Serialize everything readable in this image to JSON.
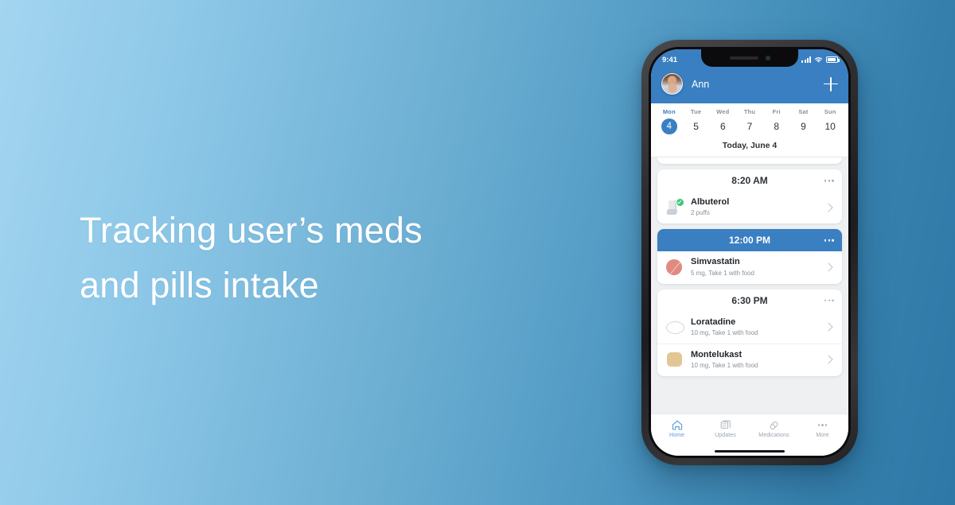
{
  "colors": {
    "brand_blue": "#3a7fc1",
    "bg_light": "#a3d5f0",
    "bg_dark": "#2d78a6",
    "accent_green": "#3fc47a",
    "muted": "#8a9097"
  },
  "promo": {
    "headline_line1": "Tracking user’s meds",
    "headline_line2": "and pills intake"
  },
  "phone": {
    "status_bar": {
      "time": "9:41",
      "signal_icon": "cellular-bars-icon",
      "wifi_icon": "wifi-icon",
      "battery_icon": "battery-icon"
    },
    "app_header": {
      "avatar_icon": "avatar",
      "user_name": "Ann",
      "add_icon": "plus-icon"
    },
    "date_strip": {
      "days": [
        {
          "name": "Mon",
          "num": "4",
          "selected": true
        },
        {
          "name": "Tue",
          "num": "5",
          "selected": false
        },
        {
          "name": "Wed",
          "num": "6",
          "selected": false
        },
        {
          "name": "Thu",
          "num": "7",
          "selected": false
        },
        {
          "name": "Fri",
          "num": "8",
          "selected": false
        },
        {
          "name": "Sat",
          "num": "9",
          "selected": false
        },
        {
          "name": "Sun",
          "num": "10",
          "selected": false
        }
      ],
      "today_label": "Today, June 4"
    },
    "schedule": [
      {
        "time": "8:20 AM",
        "highlight": false,
        "menu_icon": "more-dots-icon",
        "meds": [
          {
            "name": "Albuterol",
            "dose": "2 puffs",
            "icon": "inhaler-icon",
            "taken": true,
            "chevron_icon": "chevron-right-icon"
          }
        ]
      },
      {
        "time": "12:00 PM",
        "highlight": true,
        "menu_icon": "more-dots-icon",
        "meds": [
          {
            "name": "Simvastatin",
            "dose": "5 mg, Take 1 with food",
            "icon": "round-pill-icon",
            "taken": false,
            "chevron_icon": "chevron-right-icon"
          }
        ]
      },
      {
        "time": "6:30 PM",
        "highlight": false,
        "menu_icon": "more-dots-icon",
        "meds": [
          {
            "name": "Loratadine",
            "dose": "10 mg, Take 1 with food",
            "icon": "oval-pill-icon",
            "taken": false,
            "chevron_icon": "chevron-right-icon"
          },
          {
            "name": "Montelukast",
            "dose": "10 mg, Take 1 with food",
            "icon": "square-pill-icon",
            "taken": false,
            "chevron_icon": "chevron-right-icon"
          }
        ]
      }
    ],
    "tabbar": [
      {
        "label": "Home",
        "icon": "home-icon",
        "active": true
      },
      {
        "label": "Updates",
        "icon": "documents-icon",
        "active": false
      },
      {
        "label": "Medications",
        "icon": "capsule-icon",
        "active": false
      },
      {
        "label": "More",
        "icon": "more-dots-icon",
        "active": false
      }
    ]
  }
}
